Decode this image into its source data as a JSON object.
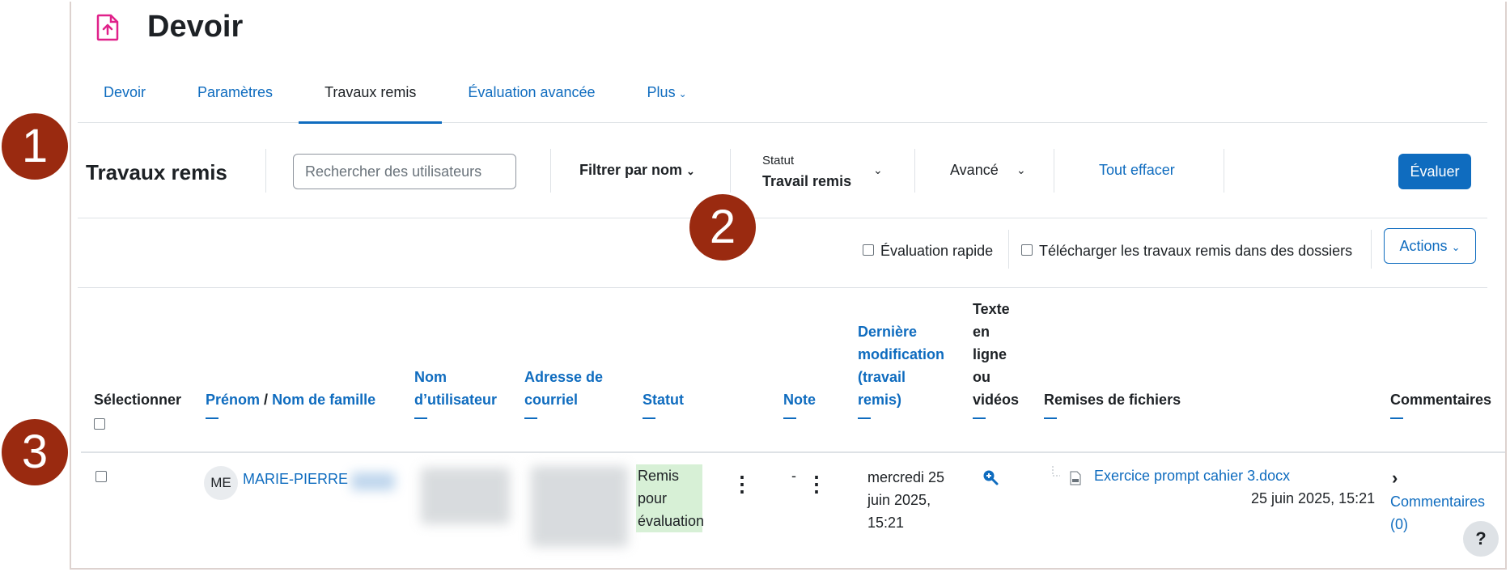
{
  "header": {
    "title": "Devoir",
    "icon": "assignment-upload-icon"
  },
  "tabs": [
    {
      "label": "Devoir"
    },
    {
      "label": "Paramètres"
    },
    {
      "label": "Travaux remis"
    },
    {
      "label": "Évaluation avancée"
    },
    {
      "label": "Plus"
    }
  ],
  "toolbar": {
    "title": "Travaux remis",
    "search_placeholder": "Rechercher des utilisateurs",
    "filter_name": "Filtrer par nom",
    "status_label": "Statut",
    "status_value": "Travail remis",
    "advanced": "Avancé",
    "clear_all": "Tout effacer",
    "grade_button": "Évaluer"
  },
  "options": {
    "quick_grading": "Évaluation rapide",
    "download_folders": "Télécharger les travaux remis dans des dossiers",
    "actions": "Actions"
  },
  "table": {
    "headers": {
      "select": "Sélectionner",
      "firstname": "Prénom",
      "slash": "/",
      "lastname": "Nom de famille",
      "username_1": "Nom",
      "username_2": "d’utilisateur",
      "email_1": "Adresse de",
      "email_2": "courriel",
      "status": "Statut",
      "grade": "Note",
      "lastmod_1": "Dernière",
      "lastmod_2": "modification",
      "lastmod_3": "(travail",
      "lastmod_4": "remis)",
      "online_1": "Texte",
      "online_2": "en",
      "online_3": "ligne",
      "online_4": "ou",
      "online_5": "vidéos",
      "files": "Remises de fichiers",
      "comments": "Commentaires"
    },
    "row": {
      "initials": "ME",
      "name": "MARIE-PIERRE",
      "status_1": "Remis",
      "status_2": "pour",
      "status_3": "évaluation",
      "grade": "-",
      "lastmod_1": "mercredi 25",
      "lastmod_2": "juin 2025,",
      "lastmod_3": "15:21",
      "file_name": "Exercice prompt cahier 3.docx",
      "file_date": "25 juin 2025, 15:21",
      "comments_1": "Commentaires",
      "comments_2": "(0)"
    }
  },
  "markers": [
    "1",
    "2",
    "3"
  ],
  "help": "?",
  "colors": {
    "link": "#0f6cbf",
    "marker": "#9a2a10",
    "status_bg": "#d7f0d6"
  }
}
